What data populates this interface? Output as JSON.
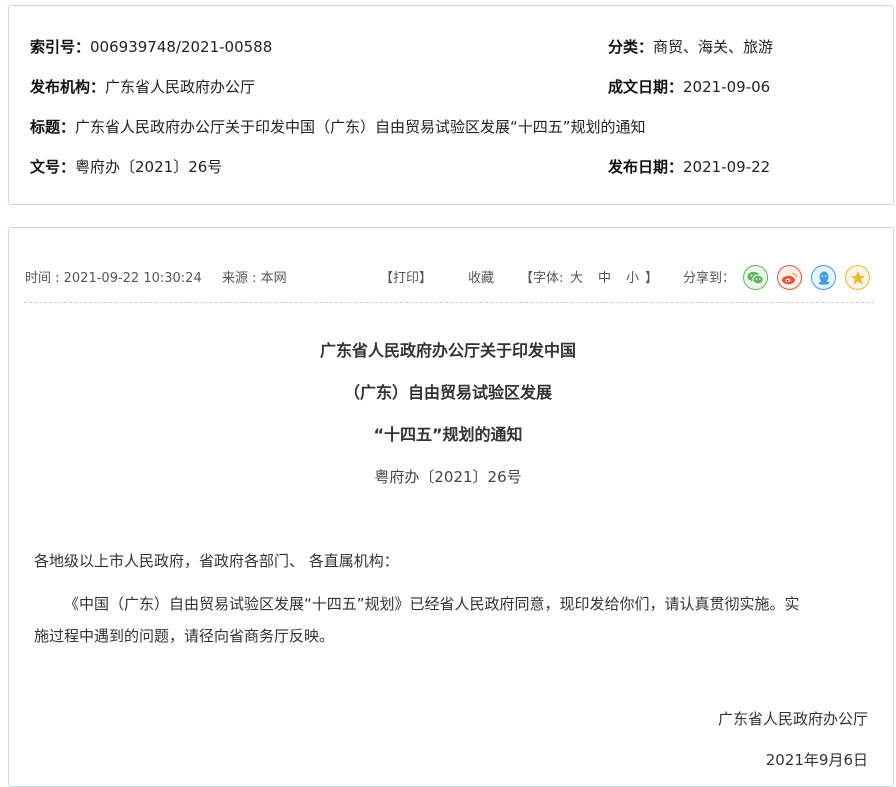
{
  "meta": {
    "index_label": "索引号：",
    "index_value": "006939748/2021-00588",
    "category_label": "分类：",
    "category_value": "商贸、海关、旅游",
    "issuer_label": "发布机构：",
    "issuer_value": "广东省人民政府办公厅",
    "created_label": "成文日期：",
    "created_value": "2021-09-06",
    "title_label": "标题：",
    "title_value": "广东省人民政府办公厅关于印发中国（广东）自由贸易试验区发展“十四五”规划的通知",
    "docno_label": "文号：",
    "docno_value": "粤府办〔2021〕26号",
    "published_label": "发布日期：",
    "published_value": "2021-09-22"
  },
  "toolbar": {
    "time": "时间 : 2021-09-22 10:30:24",
    "source": "来源 : 本网",
    "print": "【打印】",
    "favorite": "收藏",
    "font_prefix": "【字体:",
    "font_large": "大",
    "font_medium": "中",
    "font_small": "小",
    "font_suffix": "】",
    "share": "分享到："
  },
  "share_icons": [
    {
      "name": "wechat-icon",
      "color": "#5cb85c"
    },
    {
      "name": "weibo-icon",
      "color": "#e6553c"
    },
    {
      "name": "qq-icon",
      "color": "#3f9fe0"
    },
    {
      "name": "qzone-icon",
      "color": "#f0b531"
    }
  ],
  "article": {
    "title_line1": "广东省人民政府办公厅关于印发中国",
    "title_line2": "（广东）自由贸易试验区发展",
    "title_line3": "“十四五”规划的通知",
    "doc_number": "粤府办〔2021〕26号",
    "salutation": "各地级以上市人民政府，省政府各部门、 各直属机构：",
    "body_line1": "《中国（广东）自由贸易试验区发展“十四五”规划》已经省人民政府同意，现印发给你们，请认真贯彻实施。实",
    "body_line2": "施过程中遇到的问题，请径向省商务厅反映。",
    "signature": "广东省人民政府办公厅",
    "date": "2021年9月6日"
  }
}
